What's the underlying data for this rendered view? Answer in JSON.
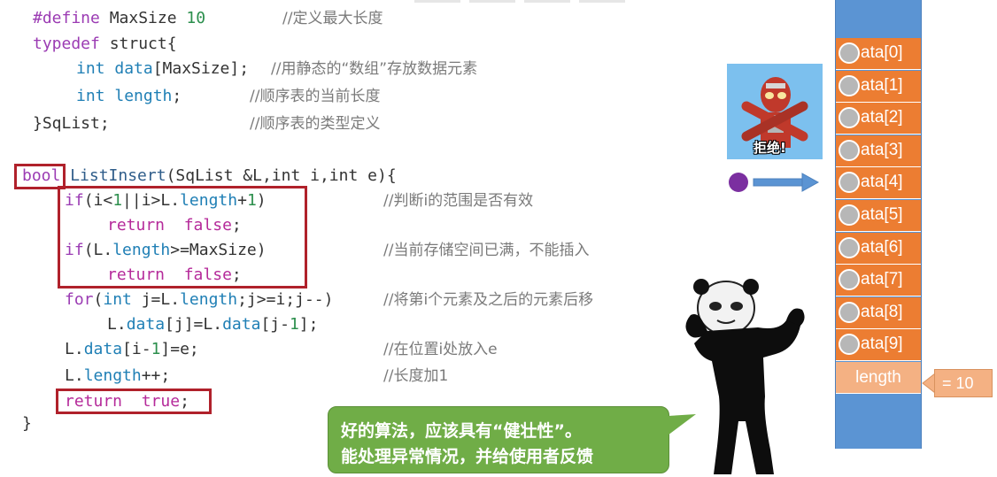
{
  "code": {
    "line1": {
      "kw": "#define",
      "name": " MaxSize ",
      "num": "10",
      "comment": "//定义最大长度"
    },
    "line2": {
      "kw": "typedef",
      "rest": " struct{"
    },
    "line3": {
      "type": "int",
      "field": " data",
      "rest": "[MaxSize];",
      "comment": "//用静态的“数组”存放数据元素"
    },
    "line4": {
      "type": "int",
      "field": " length",
      "rest": ";",
      "comment": "//顺序表的当前长度"
    },
    "line5": {
      "text": "}SqList;",
      "comment": "//顺序表的类型定义"
    },
    "line6": {
      "ret_type": "bool",
      "fn": " ListInsert",
      "rest": "(SqList &L,int i,int e){"
    },
    "line7": {
      "kw": "if",
      "pre": "(i<",
      "n1": "1",
      "mid": "||i>L.",
      "field": "length",
      "plus": "+",
      "n2": "1",
      "post": ")",
      "comment": "//判断i的范围是否有效"
    },
    "line8": {
      "kw": "return",
      "val": "false",
      "end": ";"
    },
    "line9": {
      "kw": "if",
      "pre": "(L.",
      "field": "length",
      "mid": ">=MaxSize)",
      "comment": "//当前存储空间已满，不能插入"
    },
    "line10": {
      "kw": "return",
      "val": "false",
      "end": ";"
    },
    "line11": {
      "kw": "for",
      "pre": "(",
      "type": "int",
      "mid": " j=L.",
      "field": "length",
      "post": ";j>=i;j--)",
      "comment": "//将第i个元素及之后的元素后移"
    },
    "line12": {
      "pre": "L.",
      "field": "data",
      "mid": "[j]=L.",
      "field2": "data",
      "mid2": "[j-",
      "n": "1",
      "post": "];"
    },
    "line13": {
      "pre": "L.",
      "field": "data",
      "mid": "[i-",
      "n": "1",
      "post": "]=e;",
      "comment": "//在位置i处放入e"
    },
    "line14": {
      "pre": "L.",
      "field": "length",
      "post": "++;",
      "comment": "//长度加1"
    },
    "line15": {
      "kw": "return",
      "val": "true",
      "end": ";"
    },
    "line16": {
      "text": "}"
    }
  },
  "array": {
    "cells": [
      "ata[0]",
      "ata[1]",
      "ata[2]",
      "ata[3]",
      "ata[4]",
      "ata[5]",
      "ata[6]",
      "ata[7]",
      "ata[8]",
      "ata[9]"
    ],
    "length_label": "length",
    "length_value": "= 10"
  },
  "meme": {
    "caption": "拒绝!"
  },
  "speech": {
    "line1": "好的算法，应该具有“健壮性”。",
    "line2": "能处理异常情况，并给使用者反馈"
  },
  "colors": {
    "cell": "#ec7d32",
    "array_bg": "#5b94d3",
    "highlight": "#b0212b",
    "speech": "#70ad47",
    "dot": "#7b2fa0",
    "arrow": "#5b94d3"
  }
}
